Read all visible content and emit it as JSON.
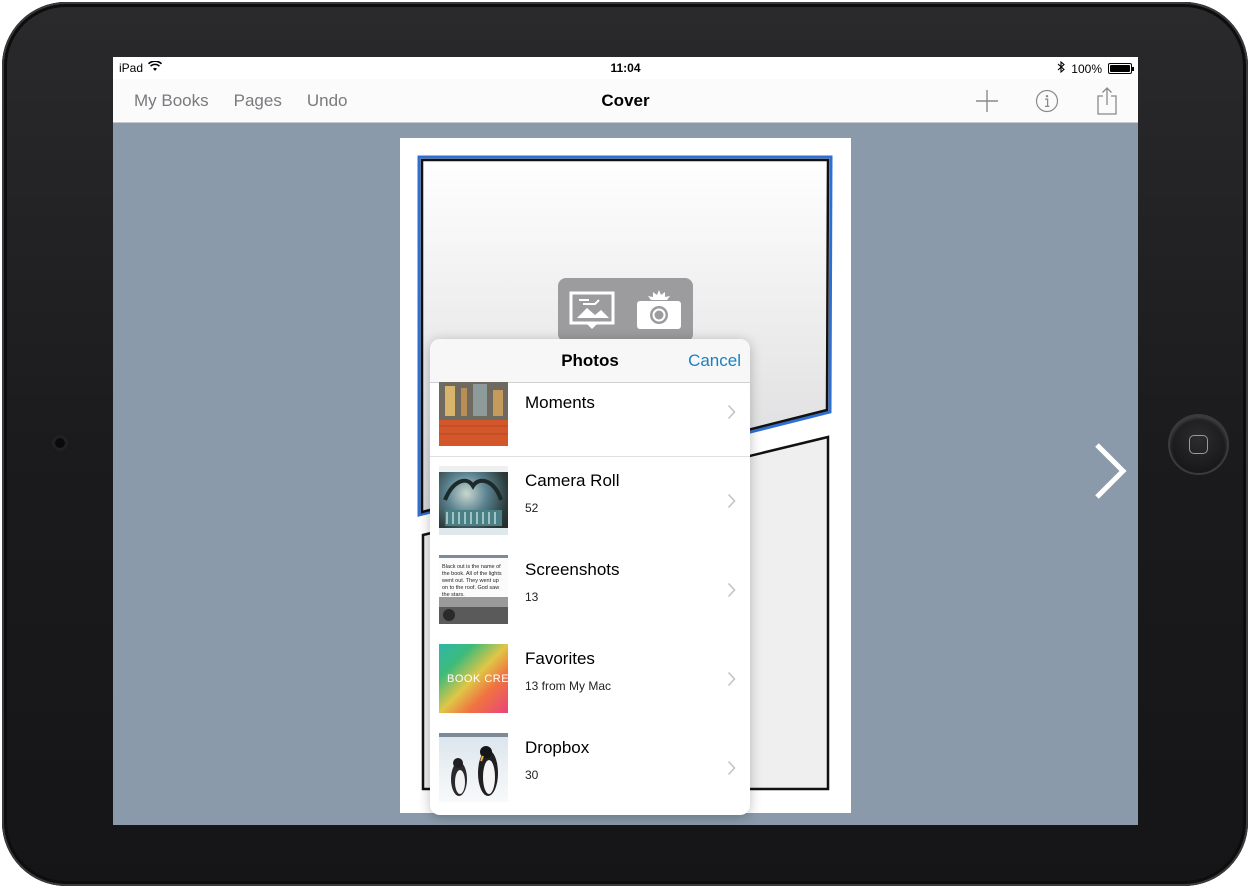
{
  "status_bar": {
    "device": "iPad",
    "time": "11:04",
    "battery": "100%"
  },
  "nav_bar": {
    "left_items": [
      "My Books",
      "Pages",
      "Undo"
    ],
    "title": "Cover",
    "right_icons": [
      "plus-icon",
      "info-icon",
      "share-icon"
    ]
  },
  "photos_popover": {
    "title": "Photos",
    "cancel_label": "Cancel",
    "albums": [
      {
        "name": "Moments",
        "count": ""
      },
      {
        "name": "Camera Roll",
        "count": "52"
      },
      {
        "name": "Screenshots",
        "count": "13"
      },
      {
        "name": "Favorites",
        "count": "13 from My Mac"
      },
      {
        "name": "Dropbox",
        "count": "30"
      }
    ],
    "screenshot_thumb_text": "Black out is the name of the book. All of the lights went out. They went up on to the roof. God saw the stars.",
    "favorites_thumb_text": "BOOK CRE"
  },
  "colors": {
    "canvas": "#8b9aaa",
    "accent": "#1a82c4",
    "selected_panel_border": "#2f6fd1"
  }
}
